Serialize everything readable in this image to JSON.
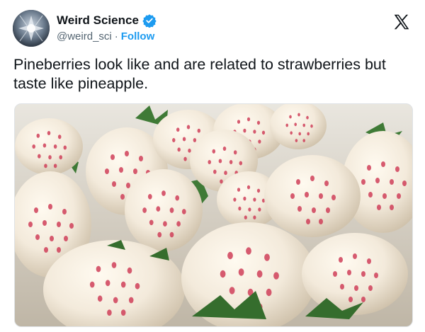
{
  "author": {
    "display_name": "Weird Science",
    "handle": "@weird_sci",
    "separator": "·",
    "follow_label": "Follow",
    "verified": true
  },
  "tweet": {
    "text": "Pineberries look like and are related to strawberries but taste like pineapple."
  },
  "media": {
    "description_icon": "photo-of-white-pineberries"
  },
  "colors": {
    "accent": "#1d9bf0",
    "text_primary": "#0f1419",
    "text_secondary": "#536471"
  },
  "icons": [
    "verified-badge-icon",
    "x-logo-icon"
  ]
}
